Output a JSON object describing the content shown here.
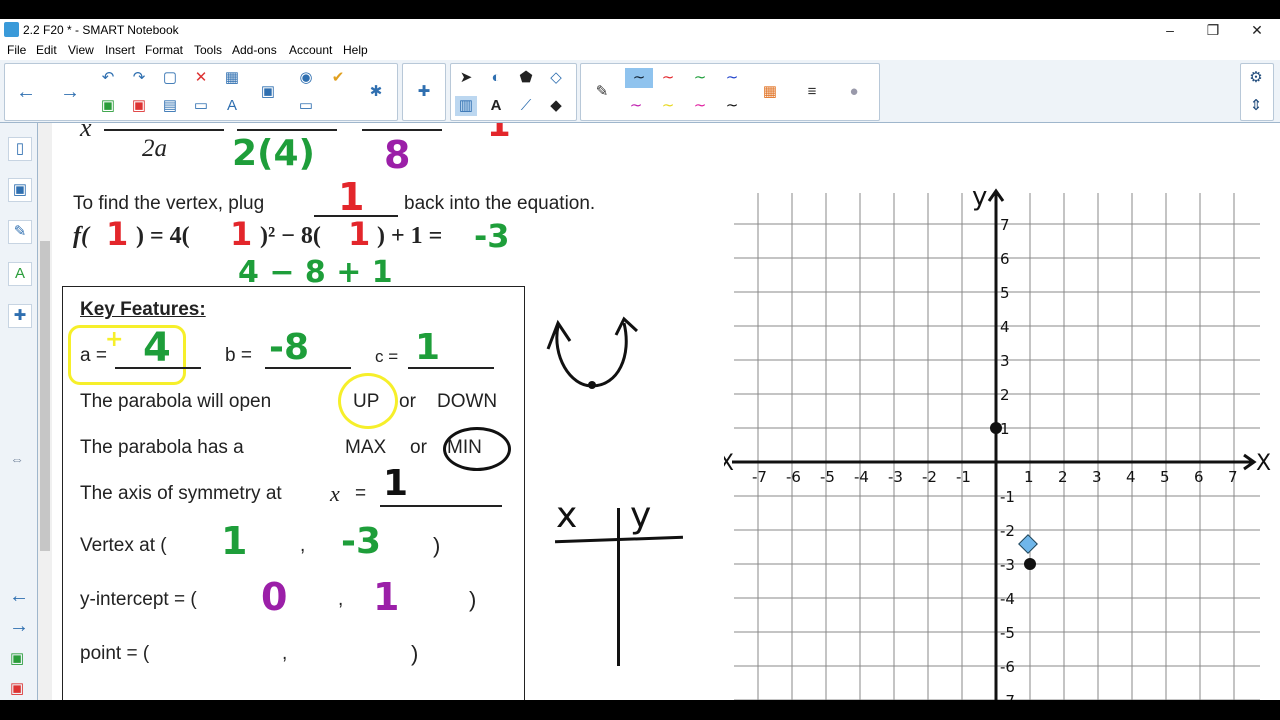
{
  "window": {
    "title": "2.2 F20 * - SMART Notebook",
    "min": "–",
    "max": "❐",
    "close": "✕"
  },
  "menu": [
    "File",
    "Edit",
    "View",
    "Insert",
    "Format",
    "Tools",
    "Add-ons",
    "Account",
    "Help"
  ],
  "colors": {
    "red": "#e3262b",
    "green": "#1e9e3a",
    "purple": "#9b1fa8",
    "yellow": "#f6ef2a",
    "accent": "#2f6fb0"
  },
  "icons": {
    "back": "←",
    "forward": "→",
    "undo": "↶",
    "redo": "↷",
    "select": "➤",
    "pen": "✎",
    "gear": "⚙",
    "updown": "⇕",
    "expand": "⇔"
  },
  "top": {
    "x_var": "x",
    "twoa": "2a",
    "denom": "2(4)",
    "eight": "8",
    "one": "1"
  },
  "vertex_line": {
    "before": "To find the vertex, plug",
    "blank": "1",
    "after": "back into the equation.",
    "f_open": "f(",
    "f_one": "1",
    "f_mid1": ") = 4(",
    "f_one2": "1",
    "f_mid2": ")² − 8(",
    "f_one3": "1",
    "f_end": ") + 1 =",
    "result": "-3",
    "work": "4 − 8 + 1"
  },
  "key_features": {
    "heading": "Key Features:",
    "a_label": "a =",
    "a_val": "4",
    "b_label": "b =",
    "b_val": "-8",
    "c_label": "c =",
    "c_val": "1",
    "open_text": "The parabola will open",
    "up": "UP",
    "or1": "or",
    "down": "DOWN",
    "has_text": "The parabola has a",
    "max": "MAX",
    "or2": "or",
    "min": "MIN",
    "axis_text": "The axis of symmetry at",
    "axis_x": "x",
    "axis_eq": "=",
    "axis_val": "1",
    "vertex_label": "Vertex at (",
    "vertex_x": "1",
    "vertex_comma": ",",
    "vertex_y": "-3",
    "vertex_close": ")",
    "yint_label": "y-intercept = (",
    "yint_x": "0",
    "yint_comma": ",",
    "yint_y": "1",
    "yint_close": ")",
    "point_label": "point = (",
    "point_comma": ",",
    "point_close": ")"
  },
  "table": {
    "x_head": "x",
    "y_head": "y"
  },
  "graph": {
    "x_label": "X",
    "neg_x_label": "-X",
    "y_label": "y",
    "x_ticks": [
      "-7",
      "-6",
      "-5",
      "-4",
      "-3",
      "-2",
      "-1",
      "1",
      "2",
      "3",
      "4",
      "5",
      "6",
      "7"
    ],
    "y_ticks": [
      "7",
      "6",
      "5",
      "4",
      "3",
      "2",
      "1",
      "-1",
      "-2",
      "-3",
      "-4",
      "-5",
      "-6",
      "-7"
    ],
    "points": [
      {
        "x": 0,
        "y": 1
      },
      {
        "x": 1,
        "y": -3
      }
    ]
  }
}
